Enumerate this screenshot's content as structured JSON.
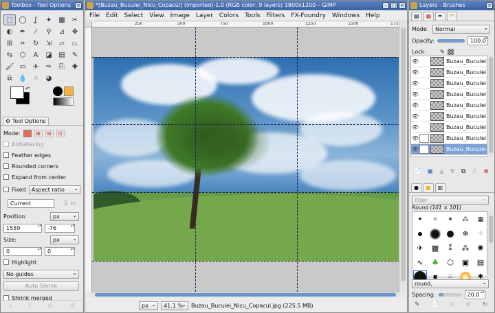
{
  "toolbox": {
    "title": "Toolbox - Tool Options",
    "tools": [
      {
        "icon": "rect-select-icon",
        "glyph": "⬚"
      },
      {
        "icon": "ellipse-select-icon",
        "glyph": "◯"
      },
      {
        "icon": "free-select-icon",
        "glyph": "ʆ"
      },
      {
        "icon": "fuzzy-select-icon",
        "glyph": "✦"
      },
      {
        "icon": "select-by-color-icon",
        "glyph": "▦"
      },
      {
        "icon": "scissors-icon",
        "glyph": "✂"
      },
      {
        "icon": "foreground-select-icon",
        "glyph": "◐"
      },
      {
        "icon": "paths-icon",
        "glyph": "✒"
      },
      {
        "icon": "color-picker-icon",
        "glyph": "⁄"
      },
      {
        "icon": "zoom-icon",
        "glyph": "⚲"
      },
      {
        "icon": "measure-icon",
        "glyph": "⊿"
      },
      {
        "icon": "move-icon",
        "glyph": "✥"
      },
      {
        "icon": "align-icon",
        "glyph": "⊞"
      },
      {
        "icon": "crop-icon",
        "glyph": "⌗"
      },
      {
        "icon": "rotate-icon",
        "glyph": "↻"
      },
      {
        "icon": "scale-icon",
        "glyph": "⇲"
      },
      {
        "icon": "shear-icon",
        "glyph": "▱"
      },
      {
        "icon": "perspective-icon",
        "glyph": "⏢"
      },
      {
        "icon": "flip-icon",
        "glyph": "⇆"
      },
      {
        "icon": "cage-icon",
        "glyph": "⬡"
      },
      {
        "icon": "text-icon",
        "glyph": "A"
      },
      {
        "icon": "bucket-fill-icon",
        "glyph": "◪"
      },
      {
        "icon": "gradient-icon",
        "glyph": "▤"
      },
      {
        "icon": "pencil-icon",
        "glyph": "✎"
      },
      {
        "icon": "paintbrush-icon",
        "glyph": "🖌"
      },
      {
        "icon": "eraser-icon",
        "glyph": "▭"
      },
      {
        "icon": "airbrush-icon",
        "glyph": "✈"
      },
      {
        "icon": "ink-icon",
        "glyph": "✑"
      },
      {
        "icon": "clone-icon",
        "glyph": "⎘"
      },
      {
        "icon": "heal-icon",
        "glyph": "✚"
      },
      {
        "icon": "perspective-clone-icon",
        "glyph": "⧉"
      },
      {
        "icon": "blur-icon",
        "glyph": "💧"
      },
      {
        "icon": "smudge-icon",
        "glyph": "☝"
      },
      {
        "icon": "dodge-burn-icon",
        "glyph": "◕"
      }
    ],
    "colors": {
      "fg": "#000000",
      "bg": "#ffffff",
      "accent": "#f8b33c"
    },
    "tool_options": {
      "tab_label": "Tool Options",
      "mode_label": "Mode:",
      "antialiasing": "Antialiasing",
      "feather_edges": "Feather edges",
      "rounded_corners": "Rounded corners",
      "expand_from_center": "Expand from center",
      "fixed_label": "Fixed",
      "fixed_value": "Aspect ratio",
      "current_value": "Current",
      "position_label": "Position:",
      "position_unit": "px",
      "position_x": "1559",
      "position_y": "-76",
      "size_label": "Size:",
      "size_unit": "px",
      "size_w": "0",
      "size_h": "0",
      "highlight": "Highlight",
      "guides_value": "No guides",
      "auto_shrink": "Auto Shrink",
      "shrink_merged": "Shrink merged"
    }
  },
  "image_window": {
    "title": "*[Buzau_Buculei_Nicu_Copacul] (imported)-1.0 (RGB color, 9 layers) 1800x1200 – GIMP",
    "menu": [
      "File",
      "Edit",
      "Select",
      "View",
      "Image",
      "Layer",
      "Colors",
      "Tools",
      "Filters",
      "FX-Foundry",
      "Windows",
      "Help"
    ],
    "ruler_labels": [
      "250",
      "500",
      "750",
      "1000",
      "1250",
      "1500",
      "1750"
    ],
    "status": {
      "unit": "px",
      "zoom": "41.1 %",
      "filename": "Buzau_Buculei_Nicu_Copacul.jpg (225.5 MB)"
    }
  },
  "layers_panel": {
    "title": "Layers - Brushes",
    "mode_label": "Mode",
    "mode_value": "Normal",
    "opacity_label": "Opacity:",
    "opacity_value": "100.0",
    "opacity_fraction": 1.0,
    "lock_label": "Lock:",
    "layers": [
      {
        "name": "Buzau_Buculei",
        "visible": true,
        "selected": false
      },
      {
        "name": "Buzau_Buculei",
        "visible": true,
        "selected": false
      },
      {
        "name": "Buzau_Buculei",
        "visible": true,
        "selected": false
      },
      {
        "name": "Buzau_Buculei",
        "visible": true,
        "selected": false
      },
      {
        "name": "Buzau_Buculei",
        "visible": true,
        "selected": false
      },
      {
        "name": "Buzau_Buculei",
        "visible": true,
        "selected": false
      },
      {
        "name": "Buzau_Buculei",
        "visible": true,
        "selected": false
      },
      {
        "name": "Buzau_Buculei",
        "visible": true,
        "selected": false
      },
      {
        "name": "Buzau_Buculei",
        "visible": true,
        "selected": true
      }
    ],
    "filter_placeholder": "filter",
    "brush_name": "Round (101 × 101)",
    "brush_tag": "round,",
    "spacing_label": "Spacing:",
    "spacing_value": "20.0"
  }
}
